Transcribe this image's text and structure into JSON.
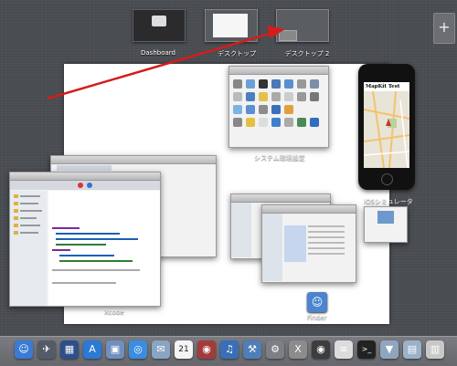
{
  "spaces": {
    "items": [
      {
        "label": "Dashboard",
        "active": false
      },
      {
        "label": "デスクトップ",
        "active": true
      },
      {
        "label": "デスクトップ 2",
        "active": false
      }
    ],
    "add_label": "+"
  },
  "windows": {
    "xcode": {
      "label": "Xcode"
    },
    "system_prefs": {
      "label": "システム環境設定"
    },
    "ios_simulator": {
      "label": "iOSシミュレータ",
      "app_title": "MapKit Test"
    },
    "finder": {
      "label": "Finder"
    }
  },
  "dock": {
    "items": [
      {
        "name": "finder-icon",
        "color": "#3a7bd5",
        "glyph": "☺"
      },
      {
        "name": "launchpad-icon",
        "color": "#555b66",
        "glyph": "✈"
      },
      {
        "name": "mission-control-icon",
        "color": "#2d4f8a",
        "glyph": "▦"
      },
      {
        "name": "app-store-icon",
        "color": "#2a7ad6",
        "glyph": "A"
      },
      {
        "name": "preview-icon",
        "color": "#6f8fbf",
        "glyph": "▣"
      },
      {
        "name": "safari-icon",
        "color": "#3b8de0",
        "glyph": "◎"
      },
      {
        "name": "mail-icon",
        "color": "#8aa4c4",
        "glyph": "✉"
      },
      {
        "name": "calendar-icon",
        "color": "#f4f4f4",
        "glyph": "21"
      },
      {
        "name": "photo-booth-icon",
        "color": "#a33b3b",
        "glyph": "◉"
      },
      {
        "name": "itunes-icon",
        "color": "#3a6fb8",
        "glyph": "♫"
      },
      {
        "name": "xcode-icon",
        "color": "#4f7fb8",
        "glyph": "⚒"
      },
      {
        "name": "system-prefs-icon",
        "color": "#7d7f84",
        "glyph": "⚙"
      },
      {
        "name": "x11-icon",
        "color": "#8c8c8c",
        "glyph": "X"
      },
      {
        "name": "camera-icon",
        "color": "#3d3d3d",
        "glyph": "◉"
      },
      {
        "name": "document-icon",
        "color": "#dcdcdc",
        "glyph": "≡"
      },
      {
        "name": "terminal-icon",
        "color": "#222",
        "glyph": ">_"
      },
      {
        "name": "downloads-folder-icon",
        "color": "#8fa6bf",
        "glyph": "▼"
      },
      {
        "name": "documents-folder-icon",
        "color": "#9bb2c9",
        "glyph": "▤"
      },
      {
        "name": "trash-icon",
        "color": "#c8c8c8",
        "glyph": "▥"
      }
    ]
  },
  "colors": {
    "arrow": "#d41c1c"
  }
}
